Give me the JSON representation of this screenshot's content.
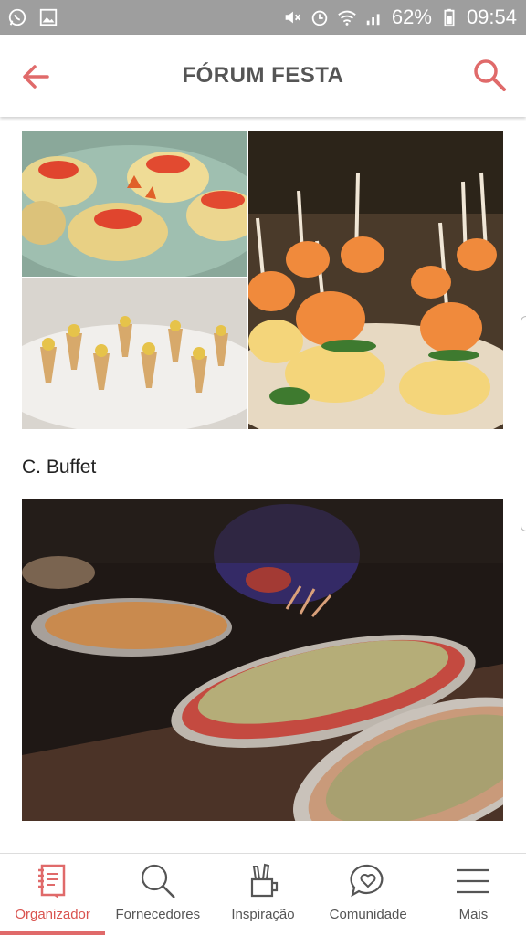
{
  "status_bar": {
    "battery": "62%",
    "time": "09:54",
    "icons": [
      "whatsapp-icon",
      "image-icon",
      "mute-icon",
      "alarm-icon",
      "wifi-icon",
      "signal-icon",
      "battery-icon"
    ]
  },
  "header": {
    "title": "FÓRUM FESTA",
    "accent_color": "#e06a6a"
  },
  "content": {
    "caption": "C. Buffet"
  },
  "bottom_nav": {
    "items": [
      {
        "label": "Organizador",
        "icon": "notebook-icon",
        "active": true
      },
      {
        "label": "Fornecedores",
        "icon": "search-icon",
        "active": false
      },
      {
        "label": "Inspiração",
        "icon": "pencil-cup-icon",
        "active": false
      },
      {
        "label": "Comunidade",
        "icon": "heart-chat-icon",
        "active": false
      },
      {
        "label": "Mais",
        "icon": "menu-icon",
        "active": false
      }
    ]
  }
}
